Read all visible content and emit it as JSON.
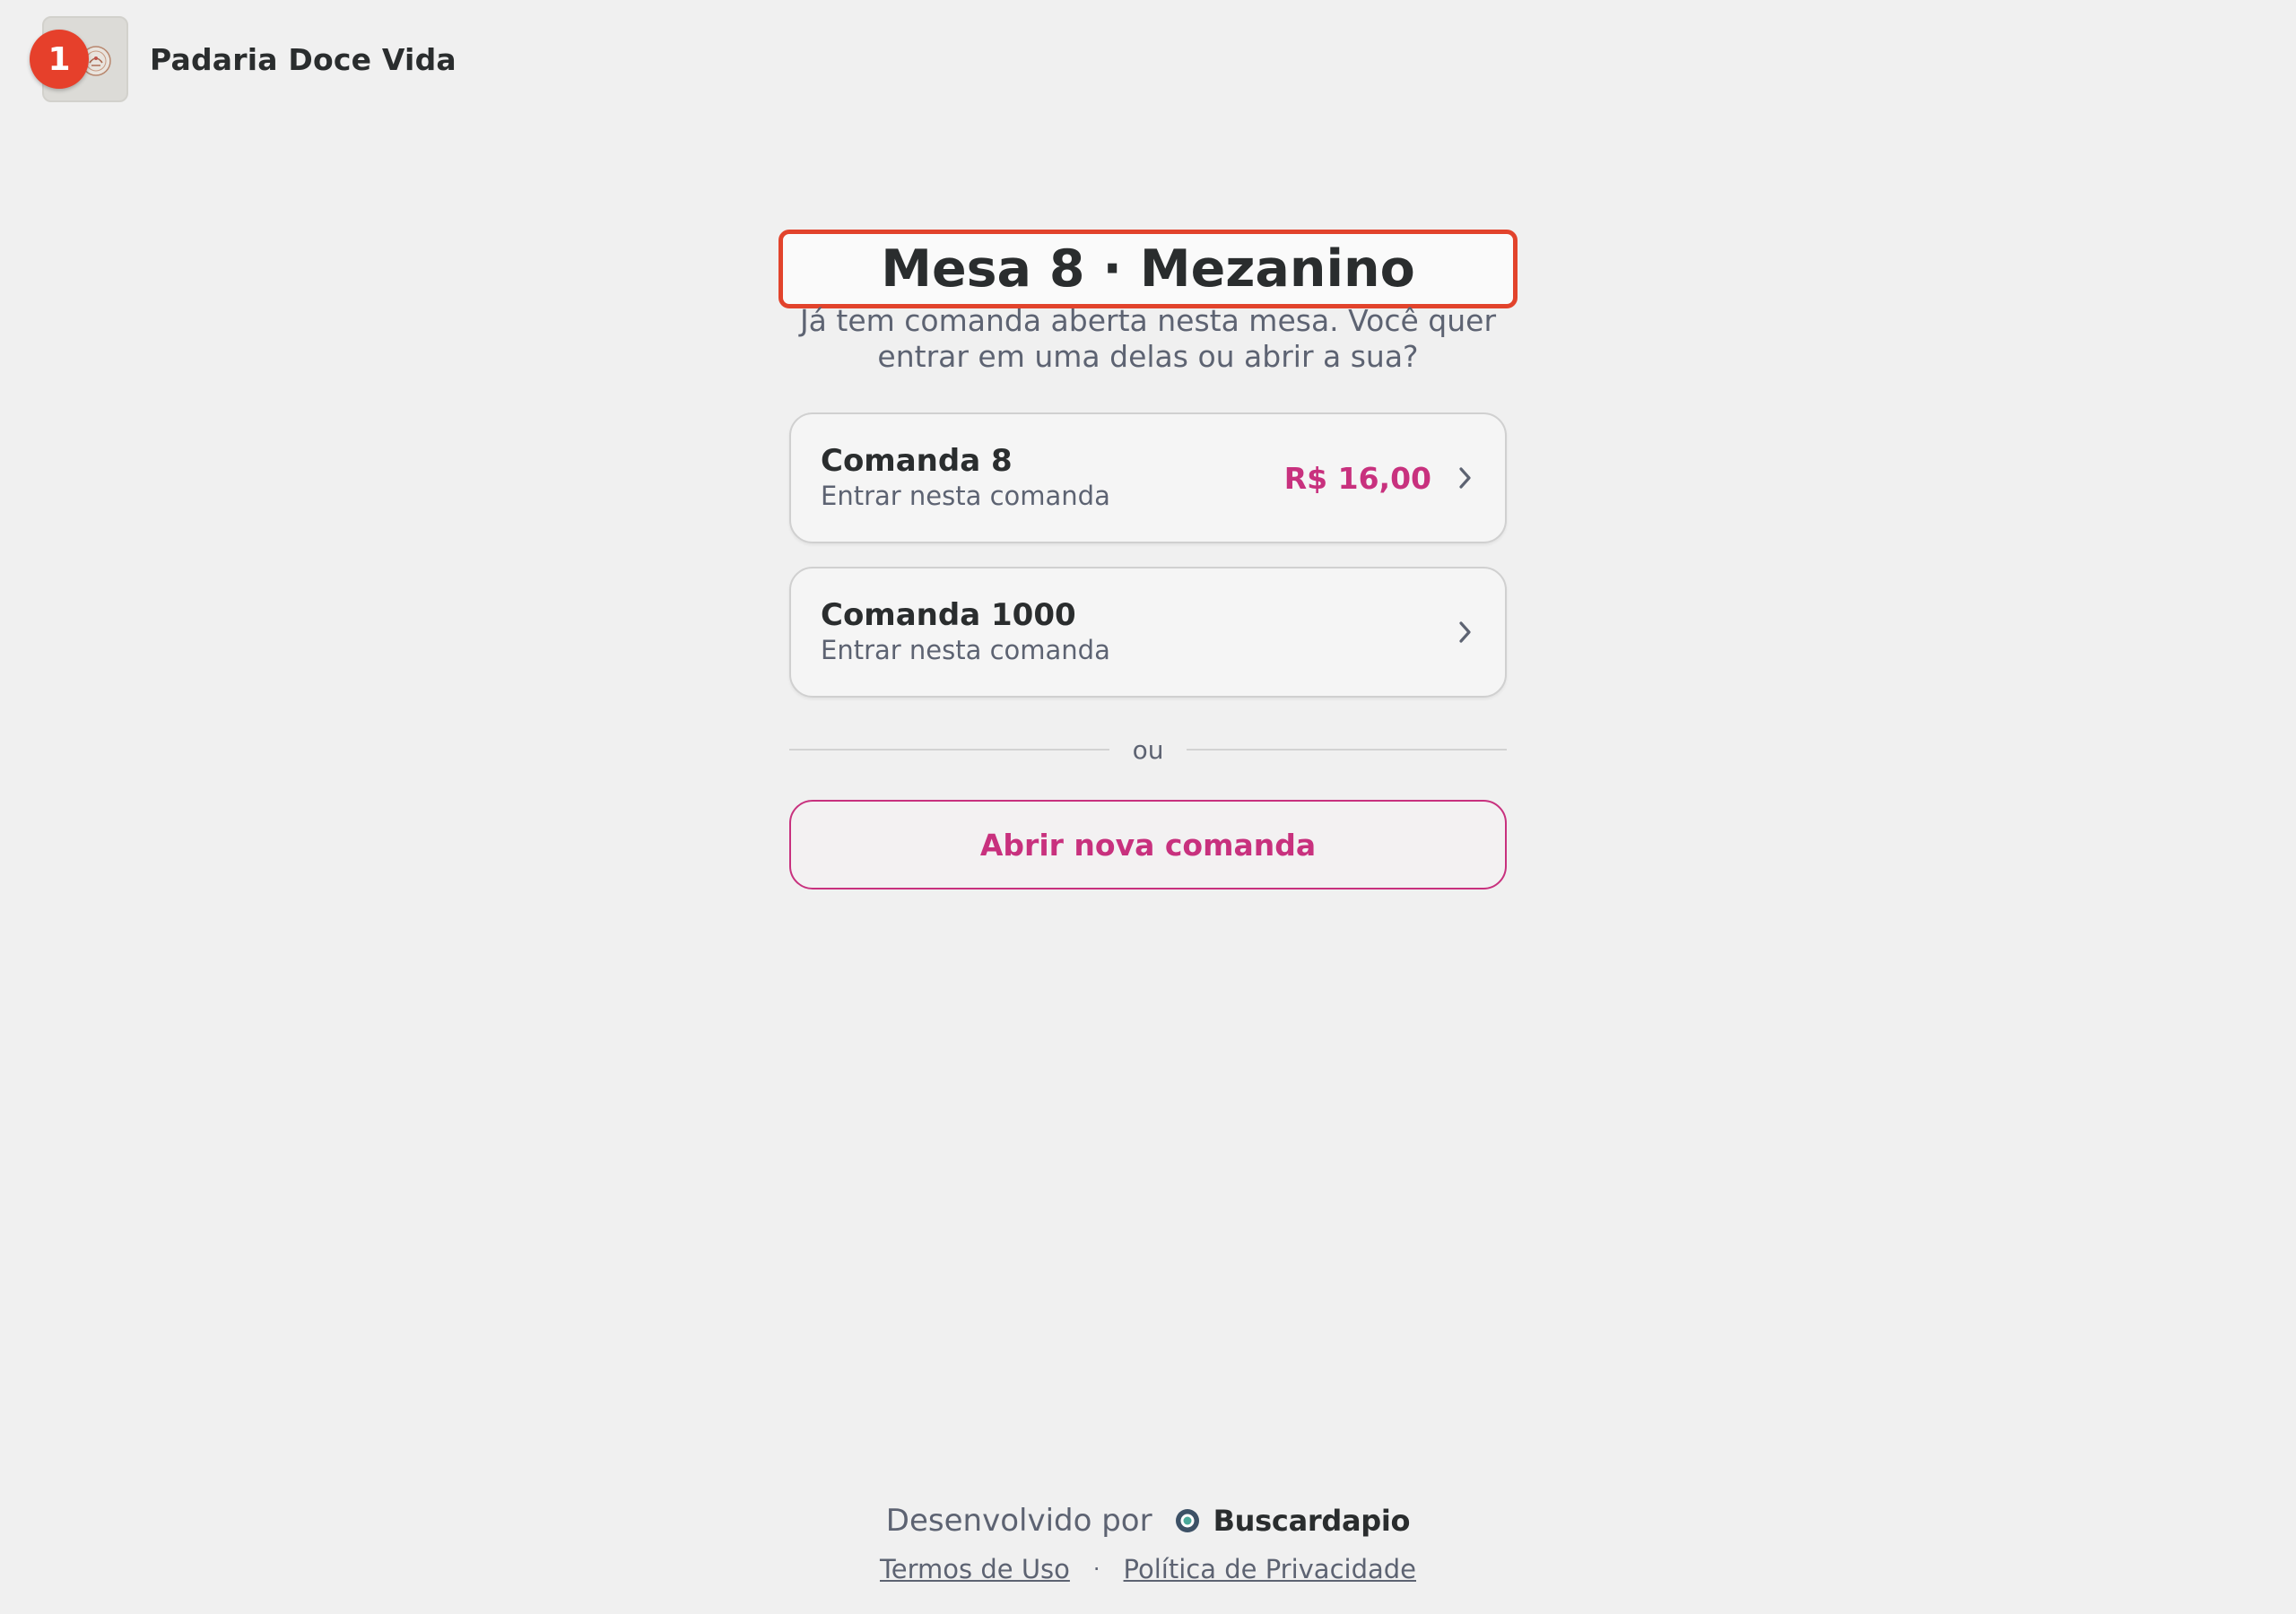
{
  "header": {
    "store_name": "Padaria Doce Vida",
    "step_badge": "1",
    "logo_icon": "bakery-emblem-icon"
  },
  "main": {
    "title": "Mesa 8 · Mezanino",
    "subtitle": "Já tem comanda aberta nesta mesa. Você quer entrar em uma delas ou abrir a sua?",
    "comandas": [
      {
        "title": "Comanda 8",
        "subtitle": "Entrar nesta comanda",
        "amount": "R$ 16,00",
        "icon": "chevron-right-icon"
      },
      {
        "title": "Comanda 1000",
        "subtitle": "Entrar nesta comanda",
        "amount": "",
        "icon": "chevron-right-icon"
      }
    ],
    "divider_text": "ou",
    "open_button_label": "Abrir nova comanda"
  },
  "footer": {
    "developed_by": "Desenvolvido por",
    "brand_name": "Buscardapio",
    "brand_icon": "buscardapio-logo-icon",
    "terms_label": "Termos de Uso",
    "separator": "·",
    "privacy_label": "Política de Privacidade"
  },
  "colors": {
    "background": "#f0f0f0",
    "accent": "#c8317e",
    "highlight": "#e2432c",
    "text_primary": "#2a2d2e",
    "text_secondary": "#5d6372"
  }
}
